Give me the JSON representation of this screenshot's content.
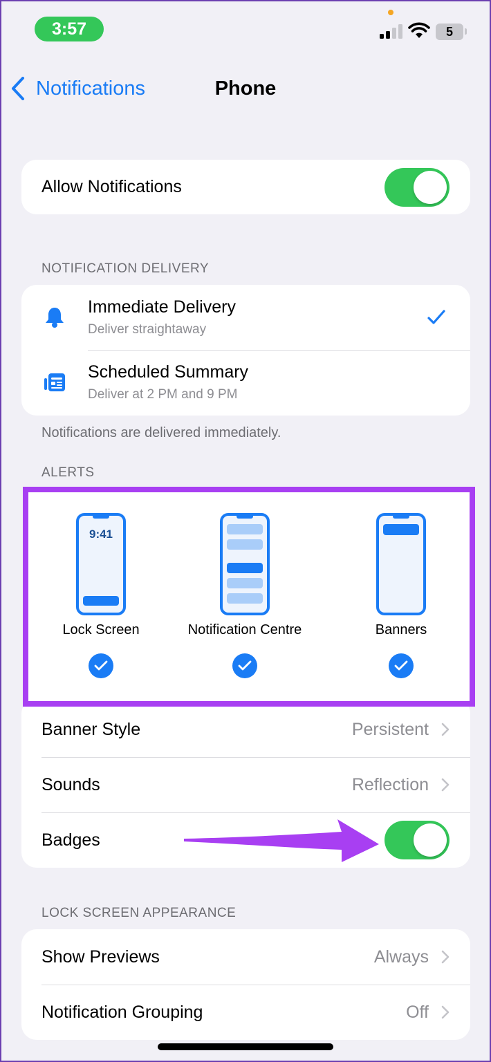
{
  "status_bar": {
    "time": "3:57",
    "battery": "5"
  },
  "nav": {
    "back_label": "Notifications",
    "title": "Phone"
  },
  "allow_notifications": {
    "label": "Allow Notifications",
    "enabled": true
  },
  "notification_delivery": {
    "header": "NOTIFICATION DELIVERY",
    "options": [
      {
        "title": "Immediate Delivery",
        "subtitle": "Deliver straightaway",
        "icon": "bell-icon",
        "selected": true
      },
      {
        "title": "Scheduled Summary",
        "subtitle": "Deliver at 2 PM and 9 PM",
        "icon": "summary-icon",
        "selected": false
      }
    ],
    "footer": "Notifications are delivered immediately."
  },
  "alerts": {
    "header": "ALERTS",
    "options": [
      {
        "label": "Lock Screen",
        "checked": true,
        "preview_time": "9:41"
      },
      {
        "label": "Notification Centre",
        "checked": true
      },
      {
        "label": "Banners",
        "checked": true
      }
    ],
    "rows": [
      {
        "label": "Banner Style",
        "value": "Persistent"
      },
      {
        "label": "Sounds",
        "value": "Reflection"
      }
    ],
    "badges": {
      "label": "Badges",
      "enabled": true
    }
  },
  "lock_screen_appearance": {
    "header": "LOCK SCREEN APPEARANCE",
    "rows": [
      {
        "label": "Show Previews",
        "value": "Always"
      },
      {
        "label": "Notification Grouping",
        "value": "Off"
      }
    ]
  },
  "colors": {
    "accent": "#1a7cf5",
    "toggle_on": "#34c759",
    "highlight": "#a83ff2",
    "background": "#f1f0f6"
  }
}
